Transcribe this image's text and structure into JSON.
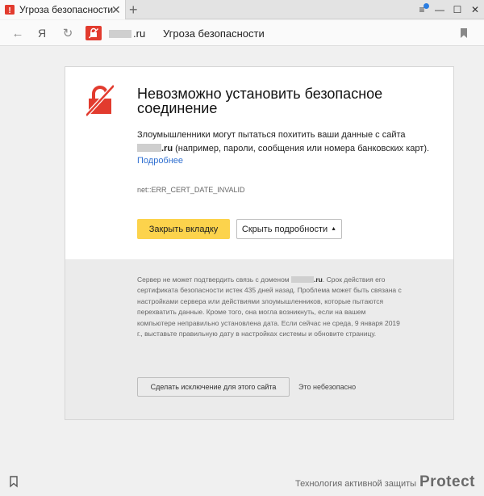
{
  "window": {
    "tab_title": "Угроза безопасности",
    "tab_close_glyph": "✕",
    "new_tab_glyph": "+",
    "menu_glyph": "≡",
    "minimize_glyph": "—",
    "maximize_glyph": "☐",
    "close_glyph": "✕"
  },
  "toolbar": {
    "back_glyph": "←",
    "yandex_glyph": "Я",
    "reload_glyph": "↻",
    "url_domain_suffix": ".ru",
    "url_page_title": "Угроза безопасности"
  },
  "error": {
    "title": "Невозможно установить безопасное соединение",
    "desc_before": "Злоумышленники могут пытаться похитить ваши данные с сайта",
    "desc_domain_suffix": ".ru",
    "desc_after": " (например, пароли, сообщения или номера банковских карт).",
    "more_link": "Подробнее",
    "error_code": "net::ERR_CERT_DATE_INVALID",
    "close_tab_button": "Закрыть вкладку",
    "hide_details_button": "Скрыть подробности",
    "hide_details_arrow": "▲",
    "details_before": "Сервер не может подтвердить связь с доменом ",
    "details_domain_suffix": ".ru",
    "details_after": ". Срок действия его сертификата безопасности истек 435 дней назад. Проблема может быть связана с настройками сервера или действиями злоумышленников, которые пытаются перехватить данные. Кроме того, она могла возникнуть, если на вашем компьютере неправильно установлена дата. Если сейчас не среда, 9 января 2019 г., выставьте правильную дату в настройках системы и обновите страницу.",
    "exception_button": "Сделать исключение для этого сайта",
    "unsafe_link": "Это небезопасно"
  },
  "footer": {
    "protect_caption": "Технология активной защиты",
    "protect_logo": "Protect"
  },
  "colors": {
    "danger": "#e23b2e",
    "primary_button": "#fcd34c",
    "link": "#2f6fd0",
    "accent_dot": "#2a7de1"
  },
  "icons": {
    "security": "unlocked-lock-crossed-icon",
    "bookmark": "bookmark-icon"
  }
}
